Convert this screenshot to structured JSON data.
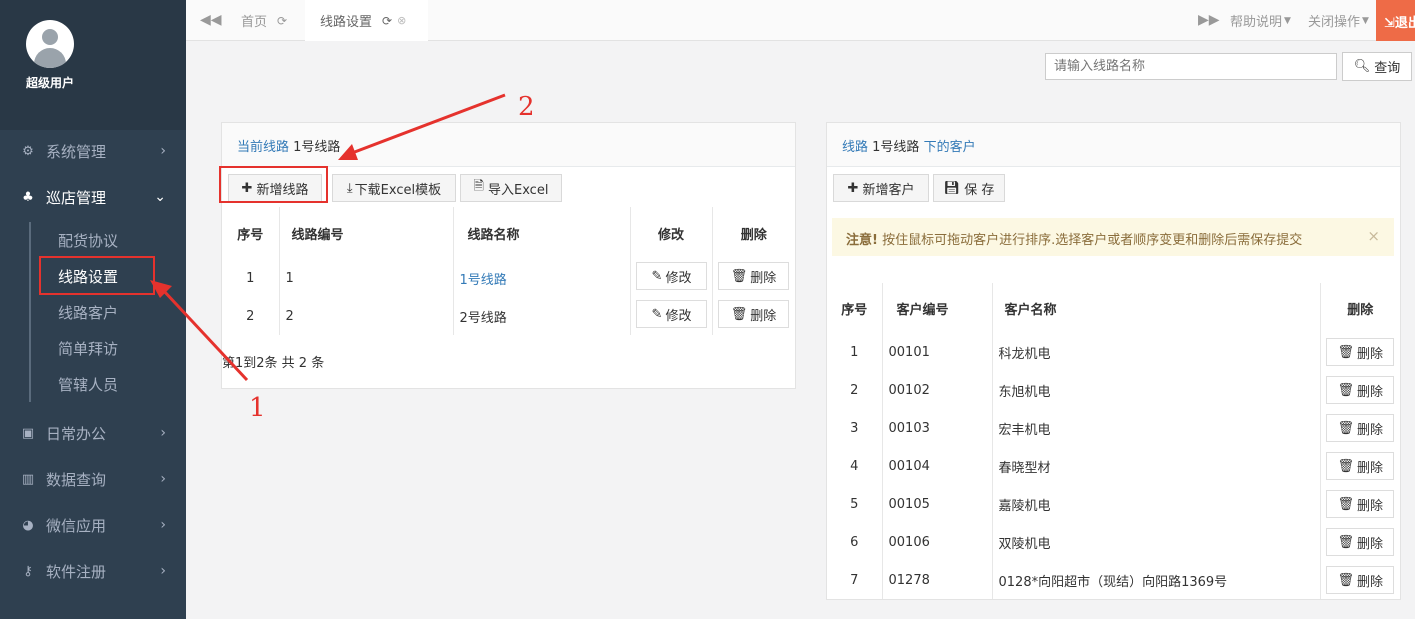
{
  "sidebar": {
    "username": "超级用户",
    "items": [
      {
        "label": "系统管理",
        "icon": "gears-icon"
      },
      {
        "label": "巡店管理",
        "icon": "sitemap-icon"
      },
      {
        "label": "日常办公",
        "icon": "briefcase-icon"
      },
      {
        "label": "数据查询",
        "icon": "bar-chart-icon"
      },
      {
        "label": "微信应用",
        "icon": "wechat-icon"
      },
      {
        "label": "软件注册",
        "icon": "key-icon"
      }
    ],
    "subitems": [
      "配货协议",
      "线路设置",
      "线路客户",
      "简单拜访",
      "管辖人员"
    ]
  },
  "tabs": [
    {
      "label": "首页"
    },
    {
      "label": "线路设置"
    }
  ],
  "topright": {
    "help": "帮助说明",
    "close_ops": "关闭操作",
    "logout": "退出"
  },
  "search": {
    "placeholder": "请输入线路名称",
    "button": "查询"
  },
  "left_panel": {
    "prefix": "当前线路",
    "current_route": "1号线路",
    "buttons": {
      "add": "新增线路",
      "download": "下载Excel模板",
      "import": "导入Excel"
    },
    "headers": [
      "序号",
      "线路编号",
      "线路名称",
      "修改",
      "删除"
    ],
    "rows": [
      {
        "seq": "1",
        "code": "1",
        "name": "1号线路",
        "edit": "修改",
        "del": "删除"
      },
      {
        "seq": "2",
        "code": "2",
        "name": "2号线路",
        "edit": "修改",
        "del": "删除"
      }
    ],
    "pagination": "第1到2条 共 2 条"
  },
  "right_panel": {
    "prefix": "线路",
    "route": "1号线路",
    "suffix": "下的客户",
    "buttons": {
      "add": "新增客户",
      "save": "保 存"
    },
    "alert_strong": "注意!",
    "alert_text": "按住鼠标可拖动客户进行排序.选择客户或者顺序变更和删除后需保存提交",
    "headers": [
      "序号",
      "客户编号",
      "客户名称",
      "删除"
    ],
    "rows": [
      {
        "seq": "1",
        "code": "00101",
        "name": "科龙机电",
        "del": "删除"
      },
      {
        "seq": "2",
        "code": "00102",
        "name": "东旭机电",
        "del": "删除"
      },
      {
        "seq": "3",
        "code": "00103",
        "name": "宏丰机电",
        "del": "删除"
      },
      {
        "seq": "4",
        "code": "00104",
        "name": "春晓型材",
        "del": "删除"
      },
      {
        "seq": "5",
        "code": "00105",
        "name": "嘉陵机电",
        "del": "删除"
      },
      {
        "seq": "6",
        "code": "00106",
        "name": "双陵机电",
        "del": "删除"
      },
      {
        "seq": "7",
        "code": "01278",
        "name": "0128*向阳超市（现结）向阳路1369号",
        "del": "删除"
      }
    ]
  },
  "annotations": {
    "one": "1",
    "two": "2"
  },
  "colors": {
    "sidebar_bg": "#2f4050",
    "link": "#337ab7",
    "annotation": "#e5322d",
    "logout_bg": "#ee6b47"
  }
}
